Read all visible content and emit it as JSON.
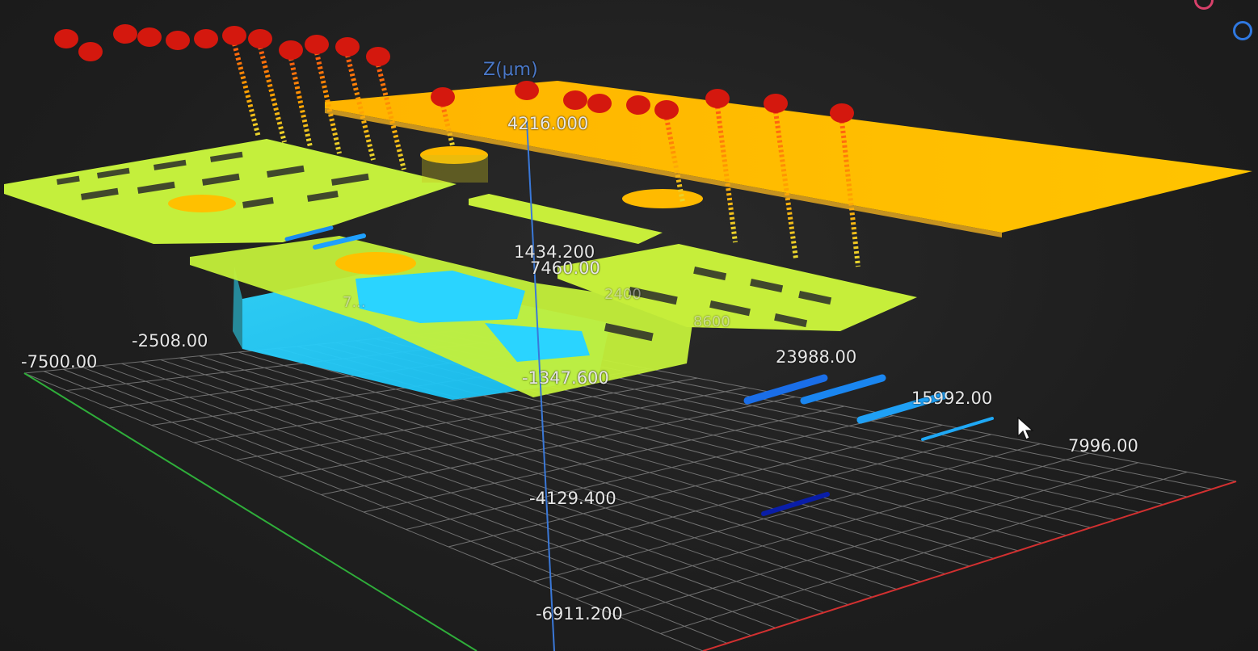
{
  "viewer": {
    "z_axis_title": "Z(μm)",
    "z_ticks": [
      "4216.000",
      "1434.200",
      "-1347.600",
      "-4129.400",
      "-6911.200"
    ],
    "y_ticks": [
      "-7500.00",
      "-2508.00",
      "7460.00"
    ],
    "x_ticks": [
      "23988.00",
      "15992.00",
      "7996.00"
    ],
    "faded_labels": [
      "2400",
      "7...",
      "8600"
    ],
    "axis_colors": {
      "x": "#d23030",
      "y": "#2fae3a",
      "z": "#3a78d8"
    },
    "corner_buttons": {
      "red": "#d8406a",
      "blue": "#2f78e0"
    },
    "colormap": [
      "#0a1aa0",
      "#1fa0ff",
      "#1fd2ff",
      "#b8f23a",
      "#e8f030",
      "#ffc000",
      "#ff9a00",
      "#d21a10"
    ]
  }
}
